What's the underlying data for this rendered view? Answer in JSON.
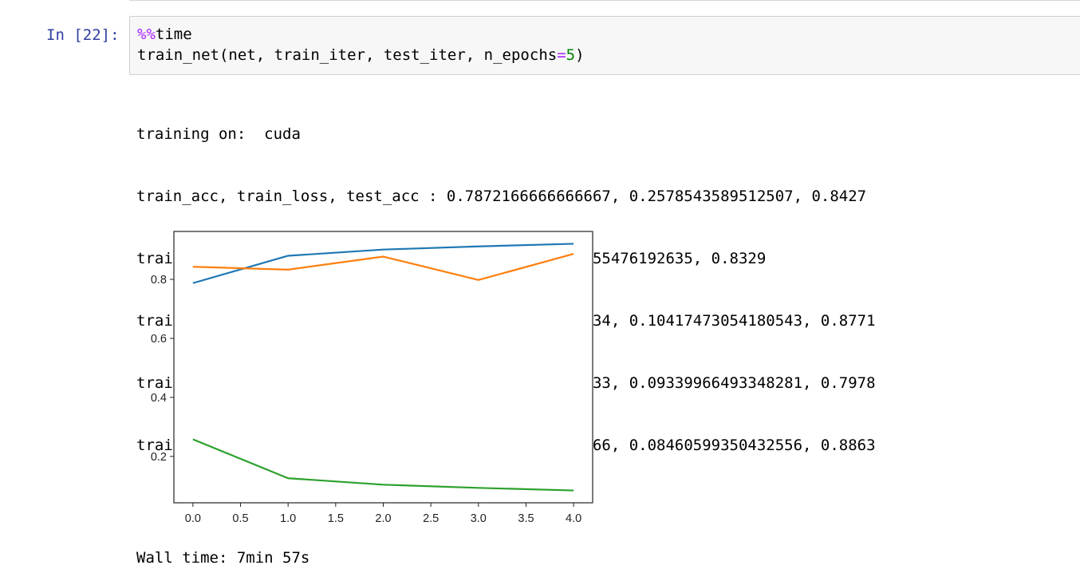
{
  "cell": {
    "prompt": "In [22]:",
    "code": {
      "magic_prefix": "%%",
      "magic_name": "time",
      "call_before_value": "train_net(net, train_iter, test_iter, n_epochs",
      "equals": "=",
      "value": "5",
      "call_after_value": ")"
    }
  },
  "output": {
    "lines": [
      "training on:  cuda",
      "train_acc, train_loss, test_acc : 0.7872166666666667, 0.2578543589512507, 0.8427",
      "train_acc, train_loss, test_acc : 0.8799, 0.12611655476192635, 0.8329",
      "train_acc, train_loss, test_acc : 0.9009333333333334, 0.10417473054180543, 0.8771",
      "train_acc, train_loss, test_acc : 0.9116333333333333, 0.09339966493348281, 0.7978",
      "train_acc, train_loss, test_acc : 0.9205166666666666, 0.08460599350432556, 0.8863"
    ],
    "wall_time": "Wall time: 7min 57s"
  },
  "chart_data": {
    "type": "line",
    "x": [
      0,
      1,
      2,
      3,
      4
    ],
    "series": [
      {
        "values": [
          0.7872,
          0.8799,
          0.9009,
          0.9116,
          0.9205
        ],
        "color": "#1f77b4"
      },
      {
        "values": [
          0.8427,
          0.8329,
          0.8771,
          0.7978,
          0.8863
        ],
        "color": "#ff7f0e"
      },
      {
        "values": [
          0.2579,
          0.1261,
          0.1042,
          0.0934,
          0.0846
        ],
        "color": "#2ca02c"
      }
    ],
    "xlim": [
      -0.2,
      4.2
    ],
    "ylim": [
      0.0429,
      0.9623
    ],
    "x_ticks": [
      0,
      0.5,
      1,
      1.5,
      2,
      2.5,
      3,
      3.5,
      4
    ],
    "x_tick_labels": [
      "0.0",
      "0.5",
      "1.0",
      "1.5",
      "2.0",
      "2.5",
      "3.0",
      "3.5",
      "4.0"
    ],
    "y_ticks": [
      0.2,
      0.4,
      0.6,
      0.8
    ],
    "y_tick_labels": [
      "0.2",
      "0.4",
      "0.6",
      "0.8"
    ],
    "grid": false,
    "legend": "none",
    "title": "",
    "xlabel": "",
    "ylabel": ""
  }
}
